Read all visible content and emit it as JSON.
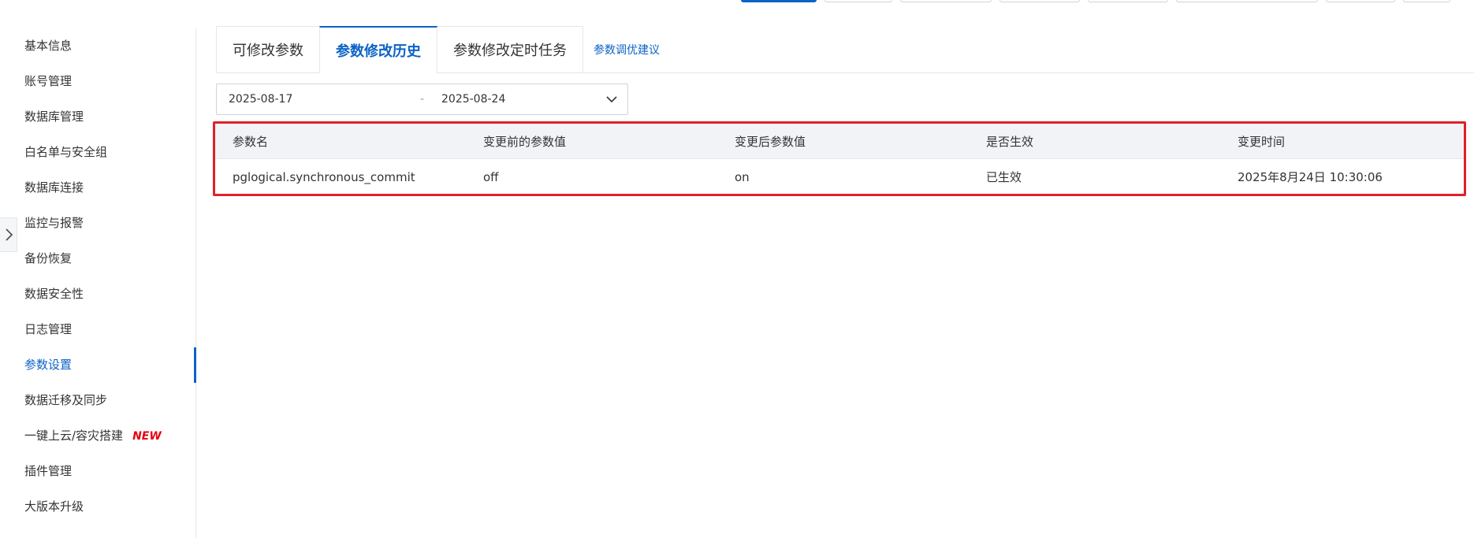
{
  "sidebar": {
    "items": [
      {
        "label": "基本信息"
      },
      {
        "label": "账号管理"
      },
      {
        "label": "数据库管理"
      },
      {
        "label": "白名单与安全组"
      },
      {
        "label": "数据库连接"
      },
      {
        "label": "监控与报警"
      },
      {
        "label": "备份恢复"
      },
      {
        "label": "数据安全性"
      },
      {
        "label": "日志管理"
      },
      {
        "label": "参数设置",
        "active": true
      },
      {
        "label": "数据迁移及同步"
      },
      {
        "label": "一键上云/容灾搭建",
        "badge": "NEW"
      },
      {
        "label": "插件管理"
      },
      {
        "label": "大版本升级"
      }
    ]
  },
  "tabs": {
    "items": [
      {
        "label": "可修改参数"
      },
      {
        "label": "参数修改历史",
        "active": true
      },
      {
        "label": "参数修改定时任务"
      }
    ],
    "link": "参数调优建议"
  },
  "date_range": {
    "start": "2025-08-17",
    "separator": "-",
    "end": "2025-08-24"
  },
  "table": {
    "columns": [
      "参数名",
      "变更前的参数值",
      "变更后参数值",
      "是否生效",
      "变更时间"
    ],
    "rows": [
      [
        "pglogical.synchronous_commit",
        "off",
        "on",
        "已生效",
        "2025年8月24日 10:30:06"
      ]
    ]
  },
  "colors": {
    "accent": "#0c62c6",
    "highlight_border": "#e0202a",
    "new_badge": "#e60012"
  }
}
